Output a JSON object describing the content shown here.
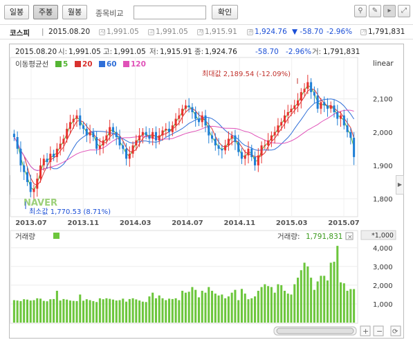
{
  "toolbar": {
    "period_buttons": [
      "일봉",
      "주봉",
      "월봉"
    ],
    "selected_period": "주봉",
    "compare_label": "종목비교",
    "compare_input_value": "",
    "confirm_label": "확인",
    "tools": [
      "pin-icon",
      "pencil-icon",
      "crosshair-icon",
      "fullscreen-icon"
    ]
  },
  "info_bar": {
    "name": "코스피",
    "date": "2015.08.20",
    "open": "1,991.05",
    "high": "1,991.05",
    "low": "1,915.91",
    "close": "1,924.76",
    "change": "▼ -58.70",
    "change_pct": "-2.96%",
    "volume": "1,791,831"
  },
  "price_panel": {
    "header": {
      "date": "2015.08.20",
      "open_label": "시:",
      "open": "1,991.05",
      "high_label": "고:",
      "high": "1,991.05",
      "low_label": "저:",
      "low": "1,915.91",
      "close_label": "종:",
      "close": "1,924.76",
      "change": "-58.70",
      "change_pct": "-2.96%",
      "volume_label": "거:",
      "volume": "1,791,831"
    },
    "ma_title": "이동평균선",
    "ma": [
      {
        "period": "5",
        "color": "#55b534"
      },
      {
        "period": "20",
        "color": "#d8322f"
      },
      {
        "period": "60",
        "color": "#2f6fd8"
      },
      {
        "period": "120",
        "color": "#e052b8"
      }
    ],
    "scale_label": "linear",
    "max_annotation": "최대값 2,189.54 (-12.09%)",
    "min_annotation": "최소값 1,770.53 (8.71%)",
    "watermark": "NAVER",
    "up_color": "#e8322f",
    "down_color": "#1f7fd6"
  },
  "x_axis_labels": [
    "2013.07",
    "2013.11",
    "2014.03",
    "2014.07",
    "2014.11",
    "2015.03",
    "2015.07"
  ],
  "volume_panel": {
    "title": "거래량",
    "legend_label": "거래량:",
    "legend_value": "1,791,831",
    "multiplier": "*1,000",
    "bar_color": "#6cc63c"
  },
  "chart_data": [
    {
      "type": "candlestick",
      "title": "",
      "ylim": [
        1750,
        2220
      ],
      "y_ticks": [
        "2,100",
        "2,000",
        "1,900",
        "1,800"
      ],
      "x_tick_labels": [
        "2013.07",
        "2013.11",
        "2014.03",
        "2014.07",
        "2014.11",
        "2015.03",
        "2015.07"
      ],
      "max_value": 2189.54,
      "min_value": 1770.53,
      "closes": [
        1985,
        1950,
        1900,
        1880,
        1850,
        1820,
        1830,
        1860,
        1900,
        1920,
        1910,
        1935,
        1925,
        1950,
        1965,
        1980,
        2010,
        2030,
        2040,
        2050,
        2020,
        2010,
        1990,
        2000,
        1985,
        1950,
        1960,
        1975,
        1990,
        2015,
        2000,
        1985,
        1960,
        1950,
        1920,
        1935,
        1960,
        1975,
        1990,
        2000,
        1990,
        1980,
        2000,
        1975,
        1990,
        2005,
        2010,
        2000,
        2020,
        2040,
        2050,
        2070,
        2080,
        2075,
        2060,
        2040,
        2030,
        2050,
        2020,
        1990,
        1980,
        1960,
        1950,
        1945,
        1960,
        1980,
        1990,
        1970,
        1940,
        1920,
        1930,
        1950,
        1925,
        1900,
        1930,
        1960,
        1960,
        1975,
        1990,
        2000,
        2020,
        2030,
        2050,
        2060,
        2070,
        2080,
        2095,
        2120,
        2130,
        2150,
        2120,
        2110,
        2070,
        2090,
        2080,
        2070,
        2080,
        2060,
        2040,
        2050,
        2020,
        2000,
        1983,
        1925
      ],
      "volume_ylim": [
        0,
        4400
      ],
      "volume_ticks": [
        "4,000",
        "3,000",
        "2,000",
        "1,000"
      ],
      "volumes": [
        1200,
        1180,
        1150,
        1250,
        1230,
        1180,
        1200,
        1300,
        1280,
        1160,
        1140,
        1250,
        1260,
        1700,
        1180,
        1260,
        1230,
        1180,
        1160,
        1150,
        1500,
        1170,
        1250,
        1200,
        1150,
        1100,
        1300,
        1250,
        1300,
        1270,
        1230,
        1180,
        1200,
        1280,
        1120,
        1260,
        1300,
        1240,
        1180,
        1120,
        1100,
        1400,
        1600,
        1300,
        1450,
        1300,
        1200,
        1280,
        1260,
        1300,
        1200,
        1700,
        1600,
        1650,
        1900,
        1750,
        1350,
        1700,
        1600,
        1900,
        1700,
        1550,
        1450,
        1500,
        1300,
        1400,
        1600,
        1750,
        1200,
        1800,
        1550,
        1250,
        1300,
        1400,
        1700,
        1900,
        2050,
        1950,
        1900,
        1600,
        2050,
        2000,
        1700,
        1550,
        1500,
        2050,
        2400,
        2800,
        3200,
        3000,
        2400,
        1750,
        2200,
        2500,
        2500,
        2250,
        3200,
        3250,
        4100,
        2150,
        2100,
        1700,
        1792,
        1792
      ]
    }
  ]
}
